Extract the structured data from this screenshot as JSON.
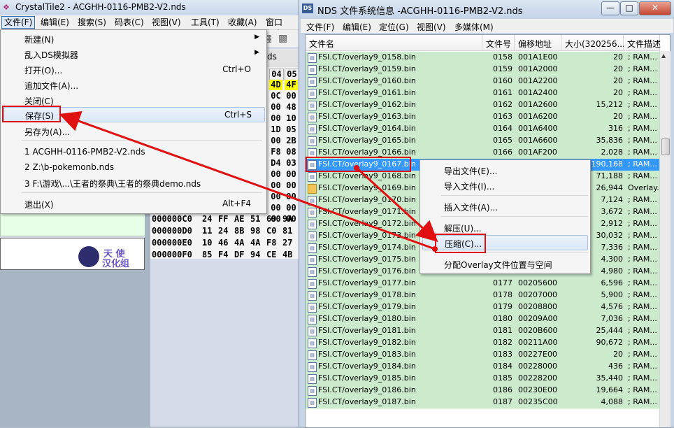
{
  "left_window": {
    "title": "CrystalTile2 - ACGHH-0116-PMB2-V2.nds",
    "app_icon": "crystal-tile-icon",
    "menubar": [
      "文件(F)",
      "编辑(E)",
      "搜索(S)",
      "码表(C)",
      "视图(V)",
      "工具(T)",
      "收藏(A)",
      "窗口(W)"
    ],
    "hex_tab_label": "ds",
    "hex_header": [
      "04",
      "05"
    ],
    "hex_first_cols": [
      [
        "4D",
        "4F"
      ],
      [
        "0C",
        "00"
      ],
      [
        "00",
        "48"
      ],
      [
        "00",
        "10"
      ],
      [
        "1D",
        "05"
      ],
      [
        "00",
        "2B"
      ],
      [
        "F8",
        "08"
      ],
      [
        "D4",
        "03"
      ],
      [
        "00",
        "00"
      ],
      [
        "00",
        "00"
      ],
      [
        "00",
        "00"
      ],
      [
        "00",
        "00"
      ],
      [
        "00",
        "00"
      ]
    ],
    "hex_rows": [
      {
        "addr": "000000C0",
        "bytes": [
          "24",
          "FF",
          "AE",
          "51",
          "69",
          "9A"
        ]
      },
      {
        "addr": "000000D0",
        "bytes": [
          "11",
          "24",
          "8B",
          "98",
          "C0",
          "81"
        ]
      },
      {
        "addr": "000000E0",
        "bytes": [
          "10",
          "46",
          "4A",
          "4A",
          "F8",
          "27"
        ]
      },
      {
        "addr": "000000F0",
        "bytes": [
          "85",
          "F4",
          "DF",
          "94",
          "CE",
          "4B"
        ]
      }
    ],
    "logo": {
      "line1": "天 使",
      "line2": "汉化组"
    }
  },
  "file_menu": {
    "items": [
      {
        "label": "新建(N)",
        "accel": "",
        "submenu": true
      },
      {
        "label": "乱入DS模拟器",
        "accel": "",
        "submenu": true
      },
      {
        "label": "打开(O)...",
        "accel": "Ctrl+O",
        "submenu": false
      },
      {
        "label": "追加文件(A)...",
        "accel": "",
        "submenu": false
      },
      {
        "label": "关闭(C)",
        "accel": "",
        "submenu": false
      },
      {
        "label": "保存(S)",
        "accel": "Ctrl+S",
        "submenu": false
      },
      {
        "label": "另存为(A)...",
        "accel": "",
        "submenu": false
      },
      {
        "label": "1 ACGHH-0116-PMB2-V2.nds",
        "accel": "",
        "submenu": false
      },
      {
        "label": "2 Z:\\b-pokemonb.nds",
        "accel": "",
        "submenu": false
      },
      {
        "label": "3 F:\\游戏\\...\\王者的祭典\\王者的祭典demo.nds",
        "accel": "",
        "submenu": false
      },
      {
        "label": "退出(X)",
        "accel": "Alt+F4",
        "submenu": false
      }
    ]
  },
  "right_window": {
    "title": "NDS 文件系统信息 -ACGHH-0116-PMB2-V2.nds",
    "app_icon": "nds-icon",
    "buttons": {
      "minimize": "—",
      "maximize": "□",
      "close": "✕"
    },
    "menubar": [
      "文件(F)",
      "编辑(E)",
      "定位(G)",
      "视图(V)",
      "多媒体(M)"
    ],
    "columns": [
      "文件名",
      "文件号",
      "偏移地址",
      "大小(320256...",
      "文件描述"
    ],
    "rows": [
      {
        "name": "FSI.CT/overlay9_0158.bin",
        "num": "0158",
        "off": "001A1E00",
        "size": "20",
        "desc": "; RAM..."
      },
      {
        "name": "FSI.CT/overlay9_0159.bin",
        "num": "0159",
        "off": "001A2000",
        "size": "20",
        "desc": "; RAM..."
      },
      {
        "name": "FSI.CT/overlay9_0160.bin",
        "num": "0160",
        "off": "001A2200",
        "size": "20",
        "desc": "; RAM..."
      },
      {
        "name": "FSI.CT/overlay9_0161.bin",
        "num": "0161",
        "off": "001A2400",
        "size": "20",
        "desc": "; RAM..."
      },
      {
        "name": "FSI.CT/overlay9_0162.bin",
        "num": "0162",
        "off": "001A2600",
        "size": "15,212",
        "desc": "; RAM..."
      },
      {
        "name": "FSI.CT/overlay9_0163.bin",
        "num": "0163",
        "off": "001A6200",
        "size": "20",
        "desc": "; RAM..."
      },
      {
        "name": "FSI.CT/overlay9_0164.bin",
        "num": "0164",
        "off": "001A6400",
        "size": "316",
        "desc": "; RAM..."
      },
      {
        "name": "FSI.CT/overlay9_0165.bin",
        "num": "0165",
        "off": "001A6600",
        "size": "35,836",
        "desc": "; RAM..."
      },
      {
        "name": "FSI.CT/overlay9_0166.bin",
        "num": "0166",
        "off": "001AF200",
        "size": "2,028",
        "desc": "; RAM..."
      },
      {
        "name": "FSI.CT/overlay9_0167.bin",
        "num": "",
        "off": "",
        "size": "190,168",
        "desc": "; RAM...",
        "selected": true
      },
      {
        "name": "FSI.CT/overlay9_0168.bin",
        "num": "",
        "off": "",
        "size": "71,188",
        "desc": "; RAM..."
      },
      {
        "name": "FSI.CT/overlay9_0169.bin",
        "num": "",
        "off": "",
        "size": "26,944",
        "desc": "Overlay...",
        "folder": true
      },
      {
        "name": "FSI.CT/overlay9_0170.bin",
        "num": "",
        "off": "",
        "size": "7,124",
        "desc": "; RAM..."
      },
      {
        "name": "FSI.CT/overlay9_0171.bin",
        "num": "",
        "off": "",
        "size": "3,672",
        "desc": "; RAM..."
      },
      {
        "name": "FSI.CT/overlay9_0172.bin",
        "num": "",
        "off": "",
        "size": "2,912",
        "desc": "; RAM..."
      },
      {
        "name": "FSI.CT/overlay9_0173.bin",
        "num": "",
        "off": "",
        "size": "30,032",
        "desc": "; RAM..."
      },
      {
        "name": "FSI.CT/overlay9_0174.bin",
        "num": "",
        "off": "",
        "size": "7,336",
        "desc": "; RAM..."
      },
      {
        "name": "FSI.CT/overlay9_0175.bin",
        "num": "",
        "off": "",
        "size": "4,300",
        "desc": "; RAM..."
      },
      {
        "name": "FSI.CT/overlay9_0176.bin",
        "num": "",
        "off": "",
        "size": "4,980",
        "desc": "; RAM..."
      },
      {
        "name": "FSI.CT/overlay9_0177.bin",
        "num": "0177",
        "off": "00205600",
        "size": "6,596",
        "desc": "; RAM..."
      },
      {
        "name": "FSI.CT/overlay9_0178.bin",
        "num": "0178",
        "off": "00207000",
        "size": "5,900",
        "desc": "; RAM..."
      },
      {
        "name": "FSI.CT/overlay9_0179.bin",
        "num": "0179",
        "off": "00208800",
        "size": "4,576",
        "desc": "; RAM..."
      },
      {
        "name": "FSI.CT/overlay9_0180.bin",
        "num": "0180",
        "off": "00209A00",
        "size": "7,036",
        "desc": "; RAM..."
      },
      {
        "name": "FSI.CT/overlay9_0181.bin",
        "num": "0181",
        "off": "0020B600",
        "size": "25,444",
        "desc": "; RAM..."
      },
      {
        "name": "FSI.CT/overlay9_0182.bin",
        "num": "0182",
        "off": "00211A00",
        "size": "90,672",
        "desc": "; RAM..."
      },
      {
        "name": "FSI.CT/overlay9_0183.bin",
        "num": "0183",
        "off": "00227E00",
        "size": "20",
        "desc": "; RAM..."
      },
      {
        "name": "FSI.CT/overlay9_0184.bin",
        "num": "0184",
        "off": "00228000",
        "size": "436",
        "desc": "; RAM..."
      },
      {
        "name": "FSI.CT/overlay9_0185.bin",
        "num": "0185",
        "off": "00228200",
        "size": "35,440",
        "desc": "; RAM..."
      },
      {
        "name": "FSI.CT/overlay9_0186.bin",
        "num": "0186",
        "off": "00230E00",
        "size": "19,664",
        "desc": "; RAM..."
      },
      {
        "name": "FSI.CT/overlay9_0187.bin",
        "num": "0187",
        "off": "00235C00",
        "size": "4,088",
        "desc": "; RAM..."
      }
    ]
  },
  "context_menu": {
    "items": [
      "导出文件(E)...",
      "导入文件(I)...",
      "插入文件(A)...",
      "解压(U)...",
      "压缩(C)...",
      "分配Overlay文件位置与空间"
    ]
  },
  "colors": {
    "row_bg": "#cceacc",
    "selected_bg": "#3399ff",
    "annotation": "#e01010"
  }
}
